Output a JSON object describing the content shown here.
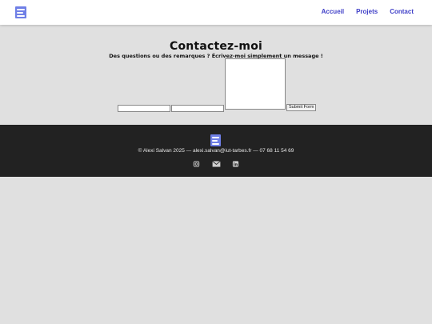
{
  "header": {
    "nav": [
      "Accueil",
      "Projets",
      "Contact"
    ]
  },
  "contact": {
    "title": "Contactez-moi",
    "subtitle": "Des questions ou des remarques ? Écrivez-moi simplement un message !",
    "name_value": "",
    "email_value": "",
    "message_value": "",
    "submit_label": "Submit Form"
  },
  "footer": {
    "copyright": "© Alexi Salvan 2025 — alexi.salvan@iut-tarbes.fr — 07 68 11 54 69",
    "socials": [
      "instagram-icon",
      "mail-icon",
      "linkedin-icon"
    ]
  },
  "colors": {
    "page_bg": "#e0e0e0",
    "nav_link": "#4040c8",
    "footer_bg": "#222222",
    "logo": "#6f7fe6"
  }
}
